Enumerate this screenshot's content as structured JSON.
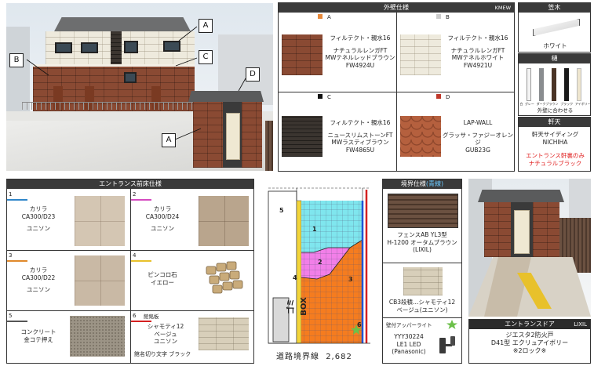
{
  "building_callouts": [
    "A",
    "B",
    "C",
    "D",
    "A"
  ],
  "exterior_wall": {
    "title": "外壁仕様",
    "maker": "KMEW",
    "items": [
      {
        "code": "A",
        "color": "#e8893a",
        "line1": "フィルテクト・親水16",
        "line2": "ナチュラルレンガFT",
        "line3": "MWテネルレッドブラウン",
        "line4": "FW4924U"
      },
      {
        "code": "B",
        "color": "#cccccc",
        "line1": "フィルテクト・親水16",
        "line2": "ナチュラルレンガFT",
        "line3": "MWテネルホワイト",
        "line4": "FW4921U"
      },
      {
        "code": "C",
        "color": "#111111",
        "line1": "フィルテクト・親水16",
        "line2": "ニュースリムストーンFT",
        "line3": "MWラスティブラウン",
        "line4": "FW4865U"
      },
      {
        "code": "D",
        "color": "#c0392b",
        "line1": "LAP-WALL",
        "line2": "グラッサ・ファジーオレンジ",
        "line3": "GUB23G",
        "line4": ""
      }
    ]
  },
  "kasagi": {
    "title": "笠木",
    "color_label": "ホワイト"
  },
  "toi": {
    "title": "樋",
    "colors": [
      "白",
      "グレー",
      "ダークブラウン",
      "ブラック",
      "アイボリー"
    ],
    "note": "外壁に合わせる"
  },
  "nokiten": {
    "title": "軒天",
    "line1": "軒天サイディング",
    "line2": "NICHIHA",
    "note1": "エントランス軒裏のみ",
    "note2": "ナチュラルブラック",
    "note_color": "#e02020"
  },
  "entrance_floor": {
    "title": "エントランス前床仕様",
    "items": [
      {
        "num": "1",
        "line_color": "#2f86c9",
        "line1": "カリラ",
        "line2": "CA300/D23",
        "line3": "ユニソン"
      },
      {
        "num": "2",
        "line_color": "#d44bc0",
        "line1": "カリラ",
        "line2": "CA300/D24",
        "line3": "ユニソン"
      },
      {
        "num": "3",
        "line_color": "#e0892b",
        "line1": "カリラ",
        "line2": "CA300/D22",
        "line3": "ユニソン"
      },
      {
        "num": "4",
        "line_color": "#e8c12b",
        "line1": "ピンコロ石",
        "line2": "イエロー",
        "line3": ""
      },
      {
        "num": "5",
        "line_color": "#555555",
        "line1": "コンクリート",
        "line2": "金コテ押え",
        "line3": ""
      },
      {
        "num": "6",
        "line_color": "#d42020",
        "label": "館銘板",
        "line1": "シャモティ12",
        "line2": "ベージュ",
        "line3": "ユニソン",
        "line4": "館名切り文字 ブラック"
      }
    ]
  },
  "plan": {
    "box_label": "ゴミBOX",
    "boundary_label": "道路境界線",
    "boundary_value": "2,682",
    "zone_numbers": [
      "1",
      "2",
      "3",
      "4",
      "5",
      "6"
    ]
  },
  "boundary": {
    "title": "境界仕様",
    "title_hl": "(青線)",
    "fence": {
      "line1": "フェンスAB  YL3型",
      "line2": "H-1200  オータムブラウン",
      "line3": "(LIXIL)"
    },
    "block": {
      "line1": "CB3段積…シャモティ12",
      "line2": "ベージュ(ユニソン)"
    },
    "light": {
      "line0": "壁付アッパーライト",
      "line1": "YYY30224",
      "line2": "LE1 LED",
      "line3": "(Panasonic)"
    }
  },
  "entrance_door": {
    "title": "エントランスドア",
    "maker": "LIXIL",
    "line1": "ジエスタ2防火戸",
    "line2": "D41型  エクリュアイボリー",
    "line3": "※2ロック※"
  }
}
